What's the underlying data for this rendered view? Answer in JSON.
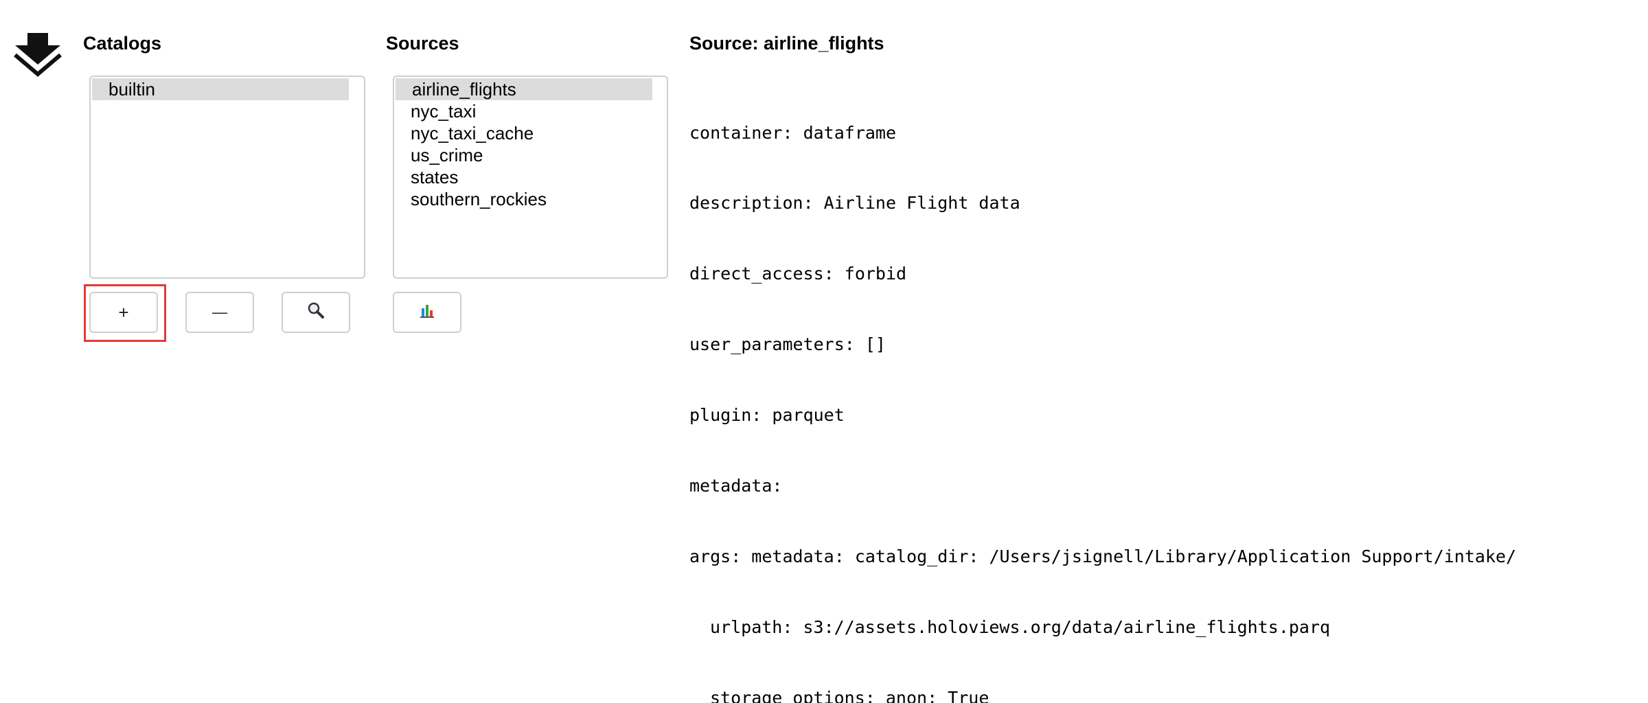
{
  "catalogs": {
    "heading": "Catalogs",
    "items": [
      {
        "label": "builtin",
        "selected": true
      }
    ],
    "buttons": {
      "add_label": "+",
      "remove_label": "—",
      "search_icon": "magnifier-icon"
    },
    "highlight_color": "#e53935"
  },
  "sources": {
    "heading": "Sources",
    "items": [
      {
        "label": "airline_flights",
        "selected": true
      },
      {
        "label": "nyc_taxi",
        "selected": false
      },
      {
        "label": "nyc_taxi_cache",
        "selected": false
      },
      {
        "label": "us_crime",
        "selected": false
      },
      {
        "label": "states",
        "selected": false
      },
      {
        "label": "southern_rockies",
        "selected": false
      }
    ],
    "buttons": {
      "plot_icon": "bar-chart-icon"
    }
  },
  "details": {
    "heading": "Source: airline_flights",
    "lines": [
      "container: dataframe",
      "description: Airline Flight data",
      "direct_access: forbid",
      "user_parameters: []",
      "plugin: parquet",
      "metadata:",
      "args: metadata: catalog_dir: /Users/jsignell/Library/Application Support/intake/"
    ],
    "indented_lines": [
      "urlpath: s3://assets.holoviews.org/data/airline_flights.parq",
      "storage_options: anon: True"
    ]
  },
  "logo_icon": "intake-logo-icon"
}
